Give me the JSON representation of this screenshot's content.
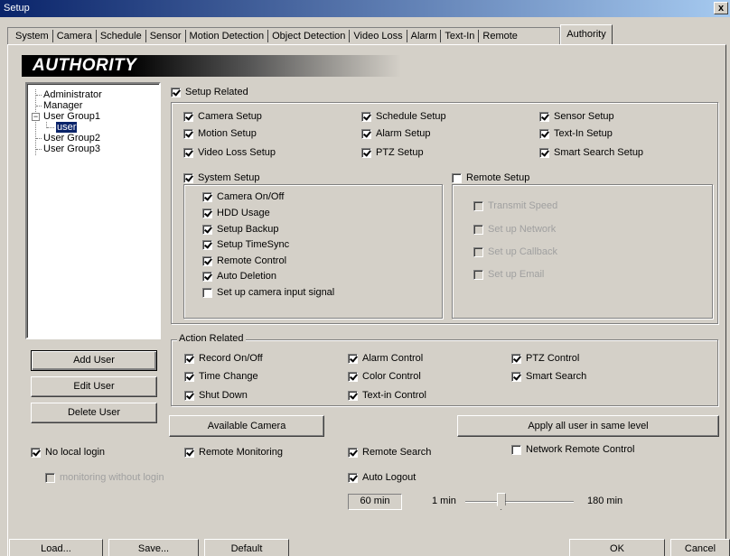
{
  "window": {
    "title": "Setup",
    "close_label": "x"
  },
  "tabs": [
    "System",
    "Camera",
    "Schedule",
    "Sensor",
    "Motion Detection",
    "Object Detection",
    "Video Loss",
    "Alarm",
    "Text-In",
    "Remote"
  ],
  "active_tab": "Authority",
  "header": "AUTHORITY",
  "tree": {
    "nodes": [
      "Administrator",
      "Manager",
      "User Group1",
      "user",
      "User Group2",
      "User Group3"
    ],
    "expand_symbol": "−"
  },
  "setup_related": {
    "label": "Setup Related",
    "checked": true,
    "items": [
      {
        "label": "Camera Setup",
        "checked": true
      },
      {
        "label": "Schedule Setup",
        "checked": true
      },
      {
        "label": "Sensor Setup",
        "checked": true
      },
      {
        "label": "Motion Setup",
        "checked": true
      },
      {
        "label": "Alarm Setup",
        "checked": true
      },
      {
        "label": "Text-In Setup",
        "checked": true
      },
      {
        "label": "Video Loss Setup",
        "checked": true
      },
      {
        "label": "PTZ Setup",
        "checked": true
      },
      {
        "label": "Smart Search Setup",
        "checked": true
      }
    ],
    "system_setup": {
      "label": "System Setup",
      "checked": true,
      "items": [
        {
          "label": "Camera On/Off",
          "checked": true
        },
        {
          "label": "HDD Usage",
          "checked": true
        },
        {
          "label": "Setup Backup",
          "checked": true
        },
        {
          "label": "Setup TimeSync",
          "checked": true
        },
        {
          "label": "Remote Control",
          "checked": true
        },
        {
          "label": "Auto Deletion",
          "checked": true
        },
        {
          "label": "Set up camera input signal",
          "checked": false
        }
      ]
    },
    "remote_setup": {
      "label": "Remote Setup",
      "checked": false,
      "items": [
        {
          "label": "Transmit Speed",
          "checked": false
        },
        {
          "label": "Set up Network",
          "checked": false
        },
        {
          "label": "Set up Callback",
          "checked": false
        },
        {
          "label": "Set up Email",
          "checked": false
        }
      ]
    }
  },
  "action_related": {
    "label": "Action Related",
    "items": [
      {
        "label": "Record On/Off",
        "checked": true
      },
      {
        "label": "Alarm Control",
        "checked": true
      },
      {
        "label": "PTZ Control",
        "checked": true
      },
      {
        "label": "Time Change",
        "checked": true
      },
      {
        "label": "Color Control",
        "checked": true
      },
      {
        "label": "Smart Search",
        "checked": true
      },
      {
        "label": "Shut Down",
        "checked": true
      },
      {
        "label": "Text-in Control",
        "checked": true
      }
    ]
  },
  "buttons": {
    "add_user": "Add User",
    "edit_user": "Edit User",
    "delete_user": "Delete User",
    "available_camera": "Available Camera",
    "apply_all": "Apply all user in same level",
    "load": "Load...",
    "save": "Save...",
    "default": "Default",
    "ok": "OK",
    "cancel": "Cancel"
  },
  "options": {
    "no_local_login": {
      "label": "No local login",
      "checked": true
    },
    "monitoring_without_login": {
      "label": "monitoring without login",
      "checked": false
    },
    "remote_monitoring": {
      "label": "Remote Monitoring",
      "checked": true
    },
    "remote_search": {
      "label": "Remote Search",
      "checked": true
    },
    "network_remote_control": {
      "label": "Network Remote Control",
      "checked": false
    },
    "auto_logout": {
      "label": "Auto Logout",
      "checked": true
    }
  },
  "auto_logout_slider": {
    "value_text": "60 min",
    "min_label": "1 min",
    "max_label": "180 min",
    "value": 60,
    "min": 1,
    "max": 180
  }
}
